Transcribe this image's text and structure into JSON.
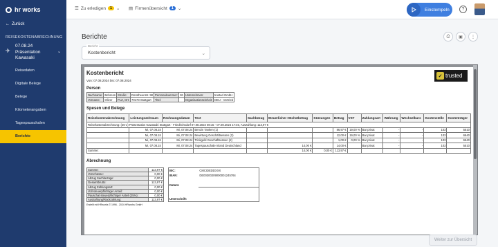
{
  "app": {
    "logo": "hr works"
  },
  "topbar": {
    "todo": {
      "label": "Zu erledigen",
      "count": "1"
    },
    "company": {
      "label": "Firmenübersicht",
      "count": "1"
    },
    "clock": {
      "label": "Einstempeln"
    },
    "icons": [
      "play-icon",
      "help-icon",
      "avatar"
    ]
  },
  "sidebar": {
    "back": "Zurück",
    "section": "REISEKOSTENABRECHNUNG",
    "trip": {
      "line1": "07.08.24",
      "line2": "Präsentation",
      "line3": "Kawasaki"
    },
    "items": [
      "Reisedaten",
      "Digitale Belege",
      "Belege",
      "Kilometerangaben",
      "Tagespauschalen",
      "Berichte"
    ]
  },
  "main": {
    "title": "Berichte",
    "select": {
      "label": "Bericht",
      "value": "Kostenbericht"
    },
    "button": "Weiter zur Übersicht"
  },
  "report": {
    "title": "Kostenbericht",
    "period": "Von: 07.08.2024 bis: 07.08.2024",
    "brand": "trusted",
    "person_heading": "Person",
    "person": [
      [
        "Nachname:",
        "Behrens",
        "Straße:",
        "Dorotheenstr. 98",
        "Personalnummer:",
        "26",
        "Unternehmen:",
        "trusted GmbH"
      ],
      [
        "Vorname:",
        "Oliver",
        "PLZ, Ort:",
        "70173 Stuttgart",
        "Titel:",
        "",
        "Organisationseinheit:",
        "DEU - Vertrieb"
      ]
    ],
    "spesen_heading": "Spesen und Belege",
    "spesen_headers": [
      "Reisekostenabrechnung",
      "Leistungszeitraum",
      "Rechnungsdatum",
      "Text",
      "Sachbezug",
      "Steuerlicher Höchstbetrag",
      "Kürzungen",
      "Betrag",
      "VST",
      "Zahlungsart",
      "Währung",
      "Wechselkurs",
      "Kostenstelle",
      "Kostenträger"
    ],
    "spesen_group": "Reisekostenabrechnung: (26-1) Präsentation Kawasaki Stuttgart - Friedrichsdorf 07.08.2024 08:15 - 07.08.2024 17:45, Auszahlung: 113,97 €",
    "spesen_rows": [
      [
        "",
        "Mi, 07.08.24",
        "Mi, 07.08.24",
        "Benzin Tanken (1)",
        "",
        "",
        "",
        "86,97 €",
        "19,00 %",
        "Bar privat",
        "-",
        "-",
        "103",
        "5510"
      ],
      [
        "",
        "Mi, 07.08.24",
        "Mi, 07.08.24",
        "Bewirtung Geschäftsessen (2)",
        "",
        "",
        "",
        "12,00 €",
        "19,00 %",
        "Bar privat",
        "-",
        "-",
        "103",
        "6640"
      ],
      [
        "",
        "Mi, 07.08.24",
        "Mi, 07.08.24",
        "Trinkgeld Geschäftsessen (2)",
        "",
        "",
        "",
        "1,00 €",
        "0,00 %",
        "Bar privat",
        "-",
        "-",
        "103",
        "6640"
      ],
      [
        "",
        "Mi, 07.08.24",
        "Mi, 07.08.24",
        "Tagespauschale Inland Deutschland",
        "",
        "14,00 €",
        "",
        "14,00 €",
        "",
        "Bar privat",
        "-",
        "-",
        "103",
        "5510"
      ]
    ],
    "spesen_total": [
      "Summe:",
      "",
      "",
      "",
      "",
      "14,00 €",
      "0,00 €",
      "113,97 €",
      "",
      "",
      "",
      "",
      "",
      ""
    ],
    "abrechnung_heading": "Abrechnung",
    "abrechnung": [
      [
        "Summe:",
        "113,97 €"
      ],
      [
        "Vorschüsse:",
        "0,00 €"
      ],
      [
        "Abzug Sachbezüge:",
        "0,00 €"
      ],
      [
        "Gesamtbrutto:",
        "113,97 €"
      ],
      [
        "Abzug Zahlungsart:",
        "0,00 €"
      ],
      [
        "Voll steuerpflichtiger Anteil:",
        "0,00 €"
      ],
      [
        "Pauschal steuerpflichtiger Anteil (25%):",
        "0,00 €"
      ],
      [
        "Auszahlung/Rückzahlung:",
        "113,97 €"
      ]
    ],
    "bank": [
      [
        "BIC:",
        "CMCIDEDDXXX"
      ],
      [
        "IBAN:",
        "DE00300209000001245764"
      ],
      [
        "",
        ""
      ],
      [
        "Datum:",
        ""
      ],
      [
        "",
        ""
      ],
      [
        "",
        ""
      ],
      [
        "Unterschrift:",
        ""
      ]
    ],
    "footer": "Erstellt mit HRworks © 1996 - 2024 HRworks GmbH"
  }
}
